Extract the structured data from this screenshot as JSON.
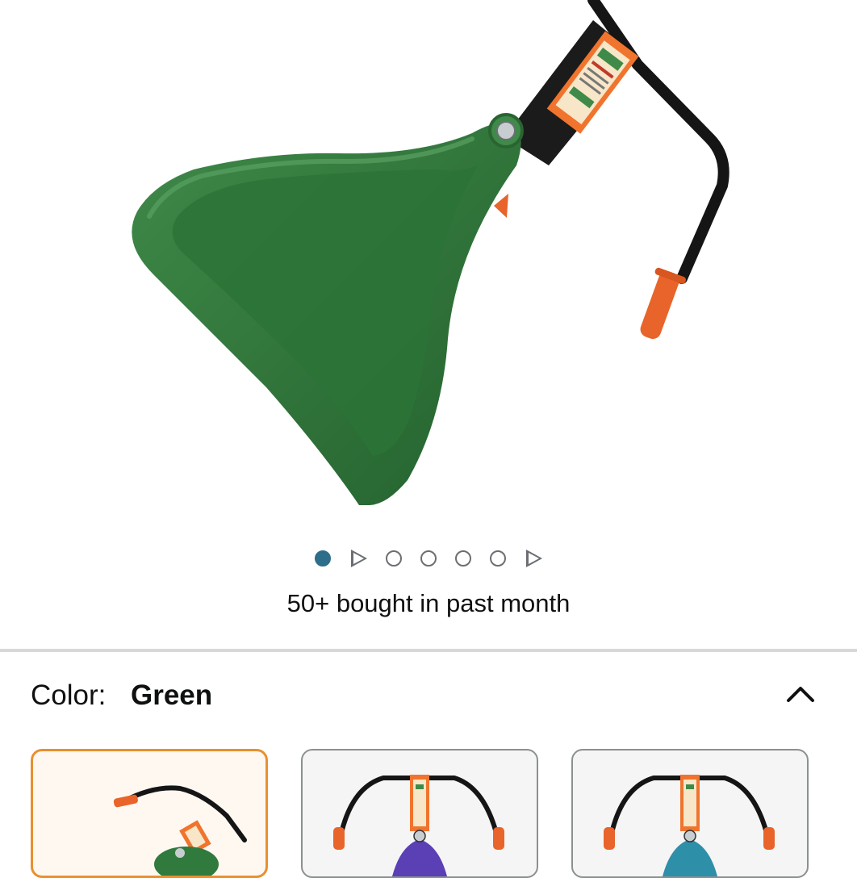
{
  "product": {
    "image_alt": "Green scooper product image",
    "bought_text": "50+ bought in past month"
  },
  "carousel": {
    "items": [
      {
        "type": "image",
        "active": true
      },
      {
        "type": "video",
        "active": false
      },
      {
        "type": "image",
        "active": false
      },
      {
        "type": "image",
        "active": false
      },
      {
        "type": "image",
        "active": false
      },
      {
        "type": "image",
        "active": false
      },
      {
        "type": "video",
        "active": false
      }
    ],
    "active_color": "#2d6e8a"
  },
  "variation": {
    "label": "Color:",
    "selected_value": "Green",
    "collapse_icon": "chevron-up-icon",
    "swatches": [
      {
        "name": "Green",
        "selected": true,
        "color": "#2f7a3c"
      },
      {
        "name": "Purple",
        "selected": false,
        "color": "#5a3fb5"
      },
      {
        "name": "Teal",
        "selected": false,
        "color": "#2e8fa8"
      }
    ],
    "selected_border_color": "#e8902f"
  }
}
